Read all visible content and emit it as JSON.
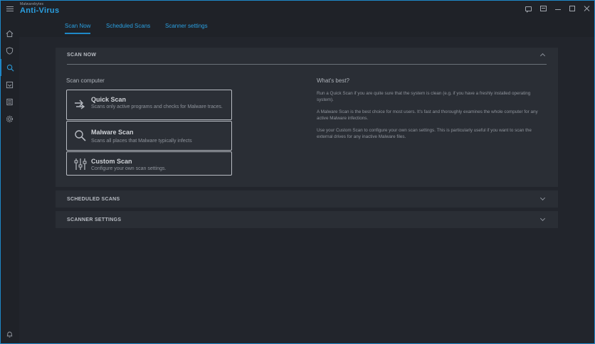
{
  "app": {
    "brand_small": "Malwarebytes",
    "brand_main": "Anti-Virus"
  },
  "titlebar_icons": [
    "chat-icon",
    "notification-icon",
    "minimize-icon",
    "maximize-icon",
    "close-icon"
  ],
  "sidebar": {
    "items": [
      {
        "icon": "home-icon"
      },
      {
        "icon": "shield-icon"
      },
      {
        "icon": "search-icon",
        "active": true
      },
      {
        "icon": "report-icon"
      },
      {
        "icon": "list-icon"
      },
      {
        "icon": "gear-icon"
      },
      {
        "icon": "bell-icon"
      }
    ]
  },
  "tabs": [
    {
      "label": "Scan Now",
      "active": true
    },
    {
      "label": "Scheduled Scans"
    },
    {
      "label": "Scanner settings"
    }
  ],
  "scan_now": {
    "header": "SCAN NOW",
    "scan_computer_label": "Scan computer",
    "buttons": {
      "quick": {
        "name": "Quick Scan",
        "desc": "Scans only active programs and checks for Malware traces."
      },
      "malware": {
        "name": "Malware Scan",
        "desc": "Scans all places that Malware typically infects"
      },
      "custom": {
        "name": "Custom Scan",
        "desc": "Configure your own scan settings."
      }
    },
    "whats_best": {
      "title": "What's best?",
      "paragraphs": [
        "Run a Quick Scan if you are quite sure that the system is clean (e.g. if you have a freshly installed operating system).",
        "A Malware Scan is the best choice for most users. It's fast and thoroughly examines the whole computer for any active Malware infections.",
        "Use your Custom Scan to configure your own scan settings. This is particularly useful if you want to scan the external drives for any inactive Malware files."
      ]
    }
  },
  "scheduled_scans": {
    "header": "SCHEDULED SCANS"
  },
  "scanner_settings": {
    "header": "SCANNER SETTINGS"
  },
  "colors": {
    "accent": "#1e88c8",
    "background": "#22252c",
    "panel": "#2a2e35"
  }
}
